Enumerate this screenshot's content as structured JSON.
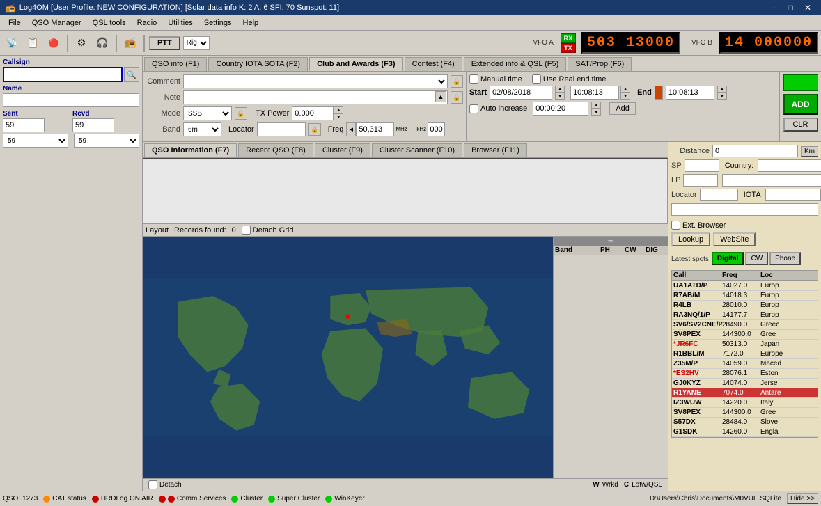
{
  "titleBar": {
    "title": "Log4OM [User Profile: NEW CONFIGURATION] [Solar data info K: 2 A: 6 SFI: 70 Sunspot: 11]",
    "minBtn": "─",
    "maxBtn": "□",
    "closeBtn": "✕"
  },
  "menuBar": {
    "items": [
      "File",
      "QSO Manager",
      "QSL tools",
      "Radio",
      "Utilities",
      "Settings",
      "Help"
    ]
  },
  "toolbar": {
    "ptt": "PTT",
    "rig": "Rig"
  },
  "vfo": {
    "labelA": "VFO A",
    "labelB": "VFO B",
    "displayA": "503 13000",
    "displayB": "14 000000",
    "rx": "RX",
    "tx": "TX"
  },
  "leftPanel": {
    "callsignLabel": "Callsign",
    "nameLabel": "Name",
    "sentLabel": "Sent",
    "rcvdLabel": "Rcvd",
    "sentValue": "59",
    "rcvdValue": "59",
    "sentSelect": "59",
    "rcvdSelect": "59",
    "callsignValue": "",
    "nameValue": ""
  },
  "tabs": {
    "upper": [
      {
        "id": "qso-info",
        "label": "QSO info (F1)"
      },
      {
        "id": "country-iota",
        "label": "Country IOTA SOTA (F2)"
      },
      {
        "id": "club-awards",
        "label": "Club and Awards (F3)"
      },
      {
        "id": "contest",
        "label": "Contest (F4)"
      },
      {
        "id": "extended-qsl",
        "label": "Extended info & QSL (F5)"
      },
      {
        "id": "sat-prop",
        "label": "SAT/Prop (F6)"
      }
    ],
    "lower": [
      {
        "id": "qso-info-f7",
        "label": "QSO Information (F7)"
      },
      {
        "id": "recent-qso",
        "label": "Recent QSO (F8)"
      },
      {
        "id": "cluster",
        "label": "Cluster (F9)"
      },
      {
        "id": "cluster-scanner",
        "label": "Cluster Scanner (F10)"
      },
      {
        "id": "browser",
        "label": "Browser (F11)"
      }
    ]
  },
  "qsoForm": {
    "commentLabel": "Comment",
    "noteLabel": "Note",
    "modeLabel": "Mode",
    "txPowerLabel": "TX Power",
    "bandLabel": "Band",
    "locatorLabel": "Locator",
    "freqLabel": "Freq",
    "modeValue": "SSB",
    "txPowerValue": "0.000",
    "bandValue": "6m",
    "freqValue": "50,313",
    "freqSuffix": "000",
    "mhzLabel": "MHz",
    "khzLabel": "kHz"
  },
  "datetime": {
    "manualTimeLabel": "Manual time",
    "useRealTimeLabel": "Use Real end time",
    "startLabel": "Start",
    "endLabel": "End",
    "dateValue": "02/08/2018",
    "startTime": "10:08:13",
    "endTime": "10:08:13",
    "autoIncreaseLabel": "Auto increase",
    "duration": "00:00:20",
    "addLabel": "Add"
  },
  "actionBtns": {
    "add": "ADD",
    "clr": "CLR"
  },
  "gridArea": {
    "layoutLabel": "Layout",
    "recordsFound": "Records found:",
    "count": "0",
    "detachGrid": "Detach Grid"
  },
  "infoPanel": {
    "distanceLabel": "Distance",
    "distanceValue": "0",
    "kmBtn": "Km",
    "spLabel": "SP",
    "lpLabel": "LP",
    "countryLabel": "Country:",
    "locatorLabel": "Locator",
    "iotaLabel": "IOTA",
    "extBrowserLabel": "Ext. Browser",
    "lookupBtn": "Lookup",
    "websiteBtn": "WebSite",
    "latestSpotsLabel": "Latest spots",
    "digitalBtn": "Digital",
    "cwBtn": "CW",
    "phoneBtn": "Phone"
  },
  "spots": [
    {
      "call": "UA1ATD/P",
      "freq": "14027.0",
      "loc": "Europ",
      "starred": false,
      "highlighted": false
    },
    {
      "call": "R7AB/M",
      "freq": "14018.3",
      "loc": "Europ",
      "starred": false,
      "highlighted": false
    },
    {
      "call": "R4LB",
      "freq": "28010.0",
      "loc": "Europ",
      "starred": false,
      "highlighted": false
    },
    {
      "call": "RA3NQ/1/P",
      "freq": "14177.7",
      "loc": "Europ",
      "starred": false,
      "highlighted": false
    },
    {
      "call": "SV6/SV2CNE/P",
      "freq": "28490.0",
      "loc": "Greec",
      "starred": false,
      "highlighted": false
    },
    {
      "call": "SV8PEX",
      "freq": "144300.0",
      "loc": "Gree",
      "starred": false,
      "highlighted": false
    },
    {
      "call": "*JR6FC",
      "freq": "50313.0",
      "loc": "Japan",
      "starred": true,
      "highlighted": false
    },
    {
      "call": "R1BBL/M",
      "freq": "7172.0",
      "loc": "Europe",
      "starred": false,
      "highlighted": false
    },
    {
      "call": "Z35M/P",
      "freq": "14059.0",
      "loc": "Maced",
      "starred": false,
      "highlighted": false
    },
    {
      "call": "*ES2HV",
      "freq": "28076.1",
      "loc": "Eston",
      "starred": true,
      "highlighted": false
    },
    {
      "call": "GJ0KYZ",
      "freq": "14074.0",
      "loc": "Jerse",
      "starred": false,
      "highlighted": false
    },
    {
      "call": "R1YANE",
      "freq": "7074.0",
      "loc": "Antare",
      "starred": false,
      "highlighted": true
    },
    {
      "call": "IZ3WUW",
      "freq": "14220.0",
      "loc": "Italy",
      "starred": false,
      "highlighted": false
    },
    {
      "call": "SV8PEX",
      "freq": "144300.0",
      "loc": "Gree",
      "starred": false,
      "highlighted": false
    },
    {
      "call": "S57DX",
      "freq": "28484.0",
      "loc": "Slove",
      "starred": false,
      "highlighted": false
    },
    {
      "call": "G1SDK",
      "freq": "14260.0",
      "loc": "Engla",
      "starred": false,
      "highlighted": false
    }
  ],
  "mapArea": {
    "detach": "Detach",
    "w": "W",
    "wrkd": "Wrkd",
    "c": "C",
    "lotw": "Lotw/QSL"
  },
  "statusBar": {
    "qso": "QSO:",
    "qsoCount": "1273",
    "catStatus": "CAT status",
    "hrdLog": "HRDLog ON AIR",
    "commServices": "Comm Services",
    "cluster": "Cluster",
    "superCluster": "Super Cluster",
    "winKeyer": "WinKeyer",
    "dbPath": "D:\\Users\\Chris\\Documents\\M0VUE.SQLite",
    "hideBtn": "Hide >>"
  }
}
